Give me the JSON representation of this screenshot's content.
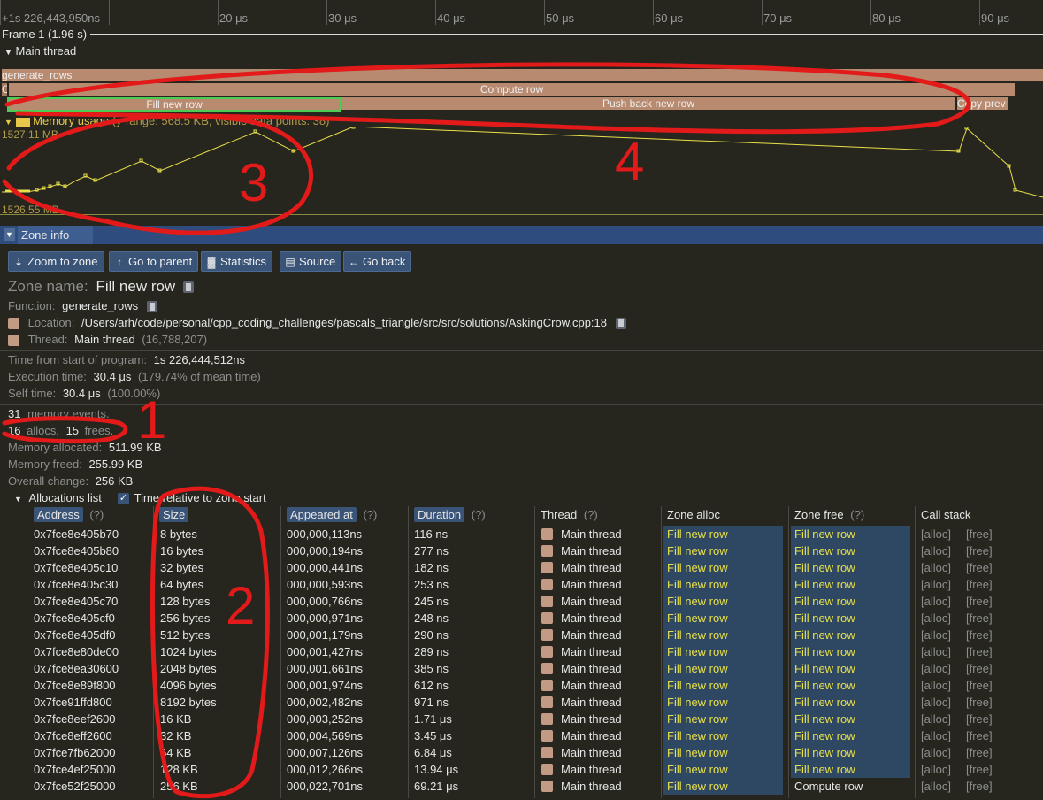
{
  "ruler": {
    "start_label": "+1s 226,443,950ns",
    "ticks": [
      "20 μs",
      "30 μs",
      "40 μs",
      "50 μs",
      "60 μs",
      "70 μs",
      "80 μs",
      "90 μs"
    ]
  },
  "frame_label": "Frame 1 (1.96 s)",
  "thread_label": "Main thread",
  "zones": {
    "top": "generate_rows",
    "middle": "Compute row",
    "middle_left": "C",
    "fill": "Fill new row",
    "push": "Push back new row",
    "copy": "Copy prev"
  },
  "memory": {
    "title": "Memory usage",
    "details": "(y-range: 568.5 KB, visible data points: 38)",
    "max_label": "1527.11 MB",
    "min_label": "1526.55 MB",
    "line_color": "#e8e04a"
  },
  "zone_info": {
    "header": "Zone info",
    "buttons": {
      "zoom": "Zoom to zone",
      "parent": "Go to parent",
      "stats": "Statistics",
      "source": "Source",
      "back": "Go back"
    },
    "zone_name_label": "Zone name:",
    "zone_name": "Fill new row",
    "function_label": "Function:",
    "function": "generate_rows",
    "location_label": "Location:",
    "location": "/Users/arh/code/personal/cpp_coding_challenges/pascals_triangle/src/src/solutions/AskingCrow.cpp:18",
    "thread_label": "Thread:",
    "thread": "Main thread",
    "thread_id": "(16,788,207)",
    "time_start_label": "Time from start of program:",
    "time_start": "1s 226,444,512ns",
    "exec_label": "Execution time:",
    "exec": "30.4 μs",
    "exec_note": "(179.74% of mean time)",
    "self_label": "Self time:",
    "self": "30.4 μs",
    "self_note": "(100.00%)",
    "mem_events_count": "31",
    "mem_events_label": "memory events.",
    "allocs_count": "16",
    "allocs_label": "allocs,",
    "frees_count": "15",
    "frees_label": "frees.",
    "mem_alloc_label": "Memory allocated:",
    "mem_alloc": "511.99 KB",
    "mem_freed_label": "Memory freed:",
    "mem_freed": "255.99 KB",
    "overall_label": "Overall change:",
    "overall": "256 KB"
  },
  "allocations": {
    "title": "Allocations list",
    "relative_label": "Time relative to zone start",
    "relative_checked": true,
    "headers": {
      "address": "Address",
      "size": "Size",
      "appeared": "Appeared at",
      "duration": "Duration",
      "thread": "Thread",
      "zone_alloc": "Zone alloc",
      "zone_free": "Zone free",
      "call_stack": "Call stack",
      "help": "(?)"
    },
    "rows": [
      [
        "0x7fce8e405b70",
        "8 bytes",
        "000,000,113ns",
        "116 ns",
        "Main thread",
        "Fill new row",
        "Fill new row",
        "[alloc]",
        "[free]"
      ],
      [
        "0x7fce8e405b80",
        "16 bytes",
        "000,000,194ns",
        "277 ns",
        "Main thread",
        "Fill new row",
        "Fill new row",
        "[alloc]",
        "[free]"
      ],
      [
        "0x7fce8e405c10",
        "32 bytes",
        "000,000,441ns",
        "182 ns",
        "Main thread",
        "Fill new row",
        "Fill new row",
        "[alloc]",
        "[free]"
      ],
      [
        "0x7fce8e405c30",
        "64 bytes",
        "000,000,593ns",
        "253 ns",
        "Main thread",
        "Fill new row",
        "Fill new row",
        "[alloc]",
        "[free]"
      ],
      [
        "0x7fce8e405c70",
        "128 bytes",
        "000,000,766ns",
        "245 ns",
        "Main thread",
        "Fill new row",
        "Fill new row",
        "[alloc]",
        "[free]"
      ],
      [
        "0x7fce8e405cf0",
        "256 bytes",
        "000,000,971ns",
        "248 ns",
        "Main thread",
        "Fill new row",
        "Fill new row",
        "[alloc]",
        "[free]"
      ],
      [
        "0x7fce8e405df0",
        "512 bytes",
        "000,001,179ns",
        "290 ns",
        "Main thread",
        "Fill new row",
        "Fill new row",
        "[alloc]",
        "[free]"
      ],
      [
        "0x7fce8e80de00",
        "1024 bytes",
        "000,001,427ns",
        "289 ns",
        "Main thread",
        "Fill new row",
        "Fill new row",
        "[alloc]",
        "[free]"
      ],
      [
        "0x7fce8ea30600",
        "2048 bytes",
        "000,001,661ns",
        "385 ns",
        "Main thread",
        "Fill new row",
        "Fill new row",
        "[alloc]",
        "[free]"
      ],
      [
        "0x7fce8e89f800",
        "4096 bytes",
        "000,001,974ns",
        "612 ns",
        "Main thread",
        "Fill new row",
        "Fill new row",
        "[alloc]",
        "[free]"
      ],
      [
        "0x7fce91ffd800",
        "8192 bytes",
        "000,002,482ns",
        "971 ns",
        "Main thread",
        "Fill new row",
        "Fill new row",
        "[alloc]",
        "[free]"
      ],
      [
        "0x7fce8eef2600",
        "16 KB",
        "000,003,252ns",
        "1.71 μs",
        "Main thread",
        "Fill new row",
        "Fill new row",
        "[alloc]",
        "[free]"
      ],
      [
        "0x7fce8eff2600",
        "32 KB",
        "000,004,569ns",
        "3.45 μs",
        "Main thread",
        "Fill new row",
        "Fill new row",
        "[alloc]",
        "[free]"
      ],
      [
        "0x7fce7fb62000",
        "64 KB",
        "000,007,126ns",
        "6.84 μs",
        "Main thread",
        "Fill new row",
        "Fill new row",
        "[alloc]",
        "[free]"
      ],
      [
        "0x7fce4ef25000",
        "128 KB",
        "000,012,266ns",
        "13.94 μs",
        "Main thread",
        "Fill new row",
        "Fill new row",
        "[alloc]",
        "[free]"
      ],
      [
        "0x7fce52f25000",
        "256 KB",
        "000,022,701ns",
        "69.21 μs",
        "Main thread",
        "Fill new row",
        "Compute row",
        "[alloc]",
        "[free]"
      ]
    ]
  },
  "annotations": [
    "1",
    "2",
    "3",
    "4"
  ],
  "colors": {
    "accent": "#2e4c7e",
    "zone": "#b88a70",
    "highlight": "#e8e04a",
    "annotation": "#e21a1a"
  }
}
